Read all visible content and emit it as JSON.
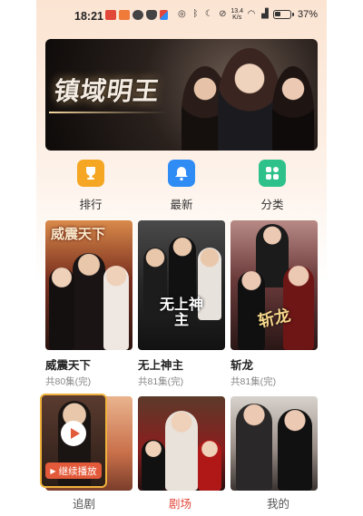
{
  "status_bar": {
    "time": "18:21",
    "net_speed_value": "13.4",
    "net_speed_unit": "K/s",
    "battery": "37%"
  },
  "banner": {
    "title": "镇域明王"
  },
  "quick_nav": [
    {
      "label": "排行",
      "icon": "trophy-icon",
      "color": "#f5a623"
    },
    {
      "label": "最新",
      "icon": "bell-icon",
      "color": "#2f8cf5"
    },
    {
      "label": "分类",
      "icon": "grid-icon",
      "color": "#2ec28a"
    }
  ],
  "dramas": [
    {
      "poster_title": "威震天下",
      "title": "威震天下",
      "episodes": "共80集(完)"
    },
    {
      "poster_title": "无上神主",
      "title": "无上神主",
      "episodes": "共81集(完)"
    },
    {
      "poster_title": "斩龙",
      "title": "斩龙",
      "episodes": "共81集(完)"
    }
  ],
  "continue_watching": {
    "label": "继续播放"
  },
  "bottom_nav": [
    {
      "label": "追剧",
      "active": false
    },
    {
      "label": "剧场",
      "active": true
    },
    {
      "label": "我的",
      "active": false
    }
  ],
  "accent_color": "#e2483a"
}
